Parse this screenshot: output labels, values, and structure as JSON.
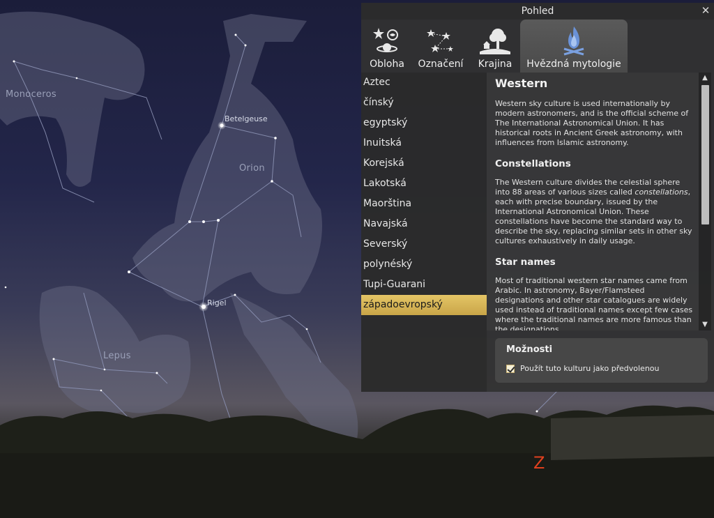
{
  "sky": {
    "constellations": {
      "monoceros": "Monoceros",
      "orion": "Orion",
      "lepus": "Lepus"
    },
    "stars": {
      "betelgeuse": "Betelgeuse",
      "rigel": "Rigel"
    },
    "cardinal": "Z"
  },
  "dialog": {
    "title": "Pohled",
    "close_icon": "close-icon",
    "tabs": [
      {
        "label": "Obloha",
        "icon": "sky-icon"
      },
      {
        "label": "Označení",
        "icon": "markings-icon"
      },
      {
        "label": "Krajina",
        "icon": "landscape-icon"
      },
      {
        "label": "Hvězdná mytologie",
        "icon": "starlore-icon",
        "active": true
      }
    ],
    "cultures": [
      "Aztec",
      "čínský",
      "egyptský",
      "Inuitská",
      "Korejská",
      "Lakotská",
      "Maorština",
      "Navajská",
      "Severský",
      "polynéský",
      "Tupi-Guarani",
      "západoevropský"
    ],
    "selected_culture": "západoevropský",
    "description": {
      "title": "Western",
      "intro": "Western sky culture is used internationally by modern astronomers, and is the official scheme of The International Astronomical Union. It has historical roots in Ancient Greek astronomy, with influences from Islamic astronomy.",
      "constellations_heading": "Constellations",
      "constellations_text_1": "The Western culture divides the celestial sphere into 88 areas of various sizes called ",
      "constellations_text_em": "constellations",
      "constellations_text_2": ", each with precise boundary, issued by the International Astronomical Union. These constellations have become the standard way to describe the sky, replacing similar sets in other sky cultures exhaustively in daily usage.",
      "star_names_heading": "Star names",
      "star_names_text": "Most of traditional western star names came from Arabic. In astronomy, Bayer/Flamsteed designations and other star catalogues are widely used instead of traditional names except few cases where the traditional names are more famous than the designations."
    },
    "options": {
      "title": "Možnosti",
      "default_label": "Použít tuto kulturu jako předvolenou",
      "default_checked": true
    }
  },
  "colors": {
    "selected_bg": "#d8b85a",
    "west_marker": "#e0401e"
  }
}
